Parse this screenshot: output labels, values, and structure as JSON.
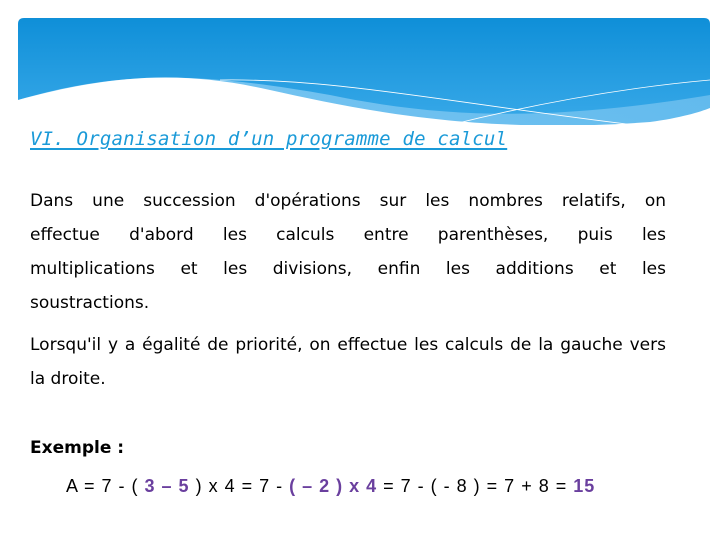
{
  "colors": {
    "title": "#1a9ad8",
    "header_dark": "#1191d8",
    "header_light": "#6fc2f0",
    "highlight": "#6a3f9e"
  },
  "title": "VI. Organisation d’un programme de calcul",
  "paragraph1": {
    "lines": [
      "Dans une succession d'opérations sur les nombres relatifs, on",
      "effectue d'abord les calculs entre parenthèses, puis les",
      "multiplications et les divisions, enfin les additions et les",
      "soustractions."
    ]
  },
  "paragraph2": "Lorsqu'il y a égalité de priorité, on effectue les calculs de la gauche vers la droite.",
  "example": {
    "label": "Exemple :",
    "formula_parts": [
      {
        "text": "A = 7 - ( ",
        "highlight": false
      },
      {
        "text": "3 – 5",
        "highlight": true
      },
      {
        "text": " ) x 4 = 7 - ",
        "highlight": false
      },
      {
        "text": "( – 2 ) x 4",
        "highlight": true
      },
      {
        "text": " = 7 - ( - 8 ) = 7 + 8 = ",
        "highlight": false
      },
      {
        "text": "15",
        "highlight": true
      }
    ]
  }
}
